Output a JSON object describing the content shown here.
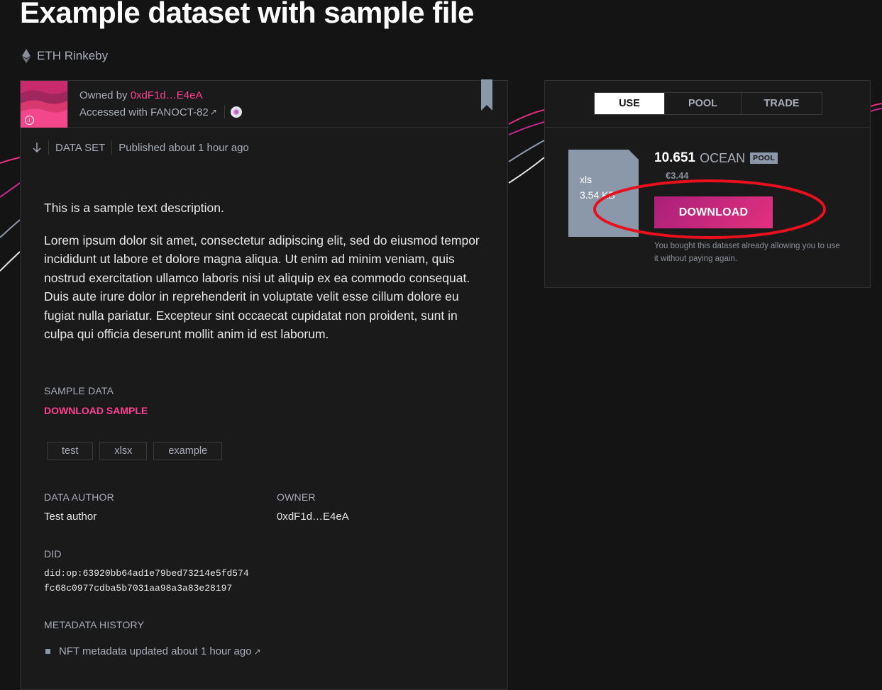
{
  "page": {
    "title": "Example dataset with sample file",
    "network": "ETH Rinkeby"
  },
  "asset": {
    "owned_by_label": "Owned by ",
    "owner_short": "0xdF1d…E4eA",
    "accessed_label": "Accessed with FANOCT-82",
    "accessed_arrow": "↗",
    "type": "DATA SET",
    "published": "Published about 1 hour ago",
    "description": [
      "This is a sample text description.",
      "Lorem ipsum dolor sit amet, consectetur adipiscing elit, sed do eiusmod tempor incididunt ut labore et dolore magna aliqua. Ut enim ad minim veniam, quis nostrud exercitation ullamco laboris nisi ut aliquip ex ea commodo consequat. Duis aute irure dolor in reprehenderit in voluptate velit esse cillum dolore eu fugiat nulla pariatur. Excepteur sint occaecat cupidatat non proident, sunt in culpa qui officia deserunt mollit anim id est laborum."
    ],
    "sample_label": "SAMPLE DATA",
    "sample_link": "DOWNLOAD SAMPLE",
    "tags": [
      "test",
      "xlsx",
      "example"
    ],
    "author_label": "DATA AUTHOR",
    "author": "Test author",
    "owner_label": "OWNER",
    "owner": "0xdF1d…E4eA",
    "did_label": "DID",
    "did_line1": "did:op:63920bb64ad1e79bed73214e5fd574",
    "did_line2": "fc68c0977cdba5b7031aa98a3a83e28197",
    "history_label": "METADATA HISTORY",
    "history_item": "NFT metadata updated about 1 hour ago",
    "history_arrow": "↗"
  },
  "sidebar": {
    "tabs": [
      {
        "label": "USE",
        "active": true
      },
      {
        "label": "POOL",
        "active": false
      },
      {
        "label": "TRADE",
        "active": false
      }
    ],
    "file_ext": "xls",
    "file_size": "3.54 KB",
    "price": "10.651",
    "price_symbol": "OCEAN",
    "price_badge": "POOL",
    "price_conversion": "€3.44",
    "download_label": "DOWNLOAD",
    "note": "You bought this dataset already allowing you to use it without paying again."
  },
  "colors": {
    "background": "#141414",
    "card": "#1a1a1a",
    "accent": "#ff4092",
    "annotation": "#e8101c"
  },
  "icons": [
    "ethereum-icon",
    "info-icon",
    "nft-icon",
    "bookmark-icon",
    "arrow-down-icon",
    "external-link-icon"
  ]
}
